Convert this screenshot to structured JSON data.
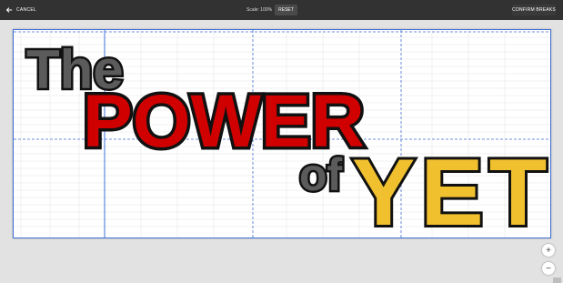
{
  "toolbar": {
    "cancel_label": "CANCEL",
    "scale_label": "Scale: 100%",
    "reset_label": "RESET",
    "confirm_label": "CONFIRM BREAKS"
  },
  "graphic": {
    "word_the": "The",
    "word_power": "POWER",
    "word_of": "of",
    "word_yet": "YET"
  },
  "zoom": {
    "zoom_in_label": "+",
    "zoom_out_label": "−"
  },
  "colors": {
    "toolbar_bg": "#323232",
    "page_break_line": "#3f6fd6",
    "power_red": "#d10000",
    "yet_yellow": "#f1c02f",
    "gray_text": "#5b5b5b"
  }
}
